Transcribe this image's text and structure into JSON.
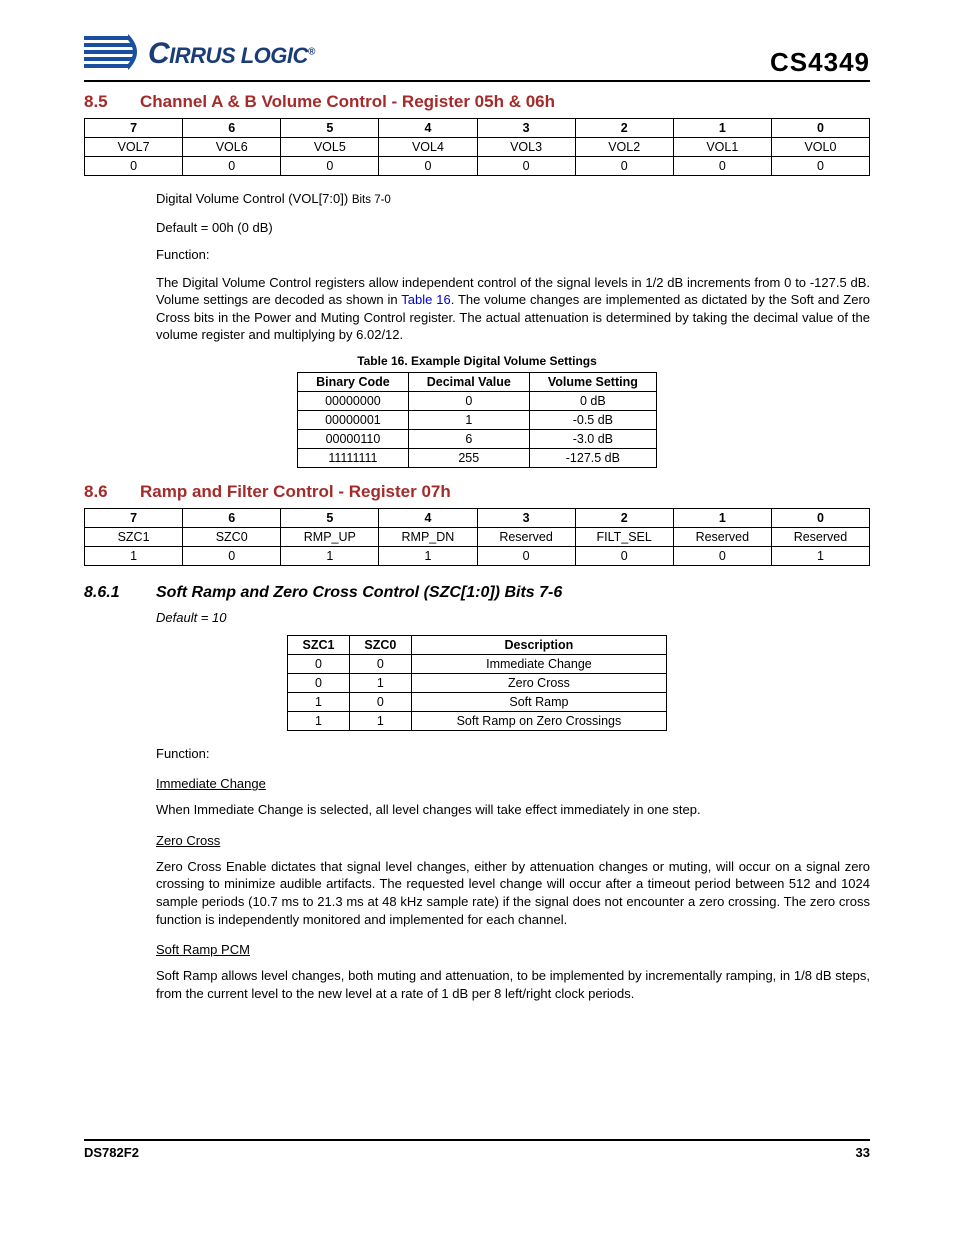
{
  "header": {
    "company": "IRRUS LOGIC",
    "part": "CS4349"
  },
  "section85": {
    "num": "8.5",
    "title": "Channel A & B Volume Control - Register 05h & 06h",
    "bits": [
      "7",
      "6",
      "5",
      "4",
      "3",
      "2",
      "1",
      "0"
    ],
    "names": [
      "VOL7",
      "VOL6",
      "VOL5",
      "VOL4",
      "VOL3",
      "VOL2",
      "VOL1",
      "VOL0"
    ],
    "reset": [
      "0",
      "0",
      "0",
      "0",
      "0",
      "0",
      "0",
      "0"
    ],
    "fieldline": "Digital Volume Control (VOL[7:0])",
    "fieldbits": "Bits 7-0",
    "default": "Default = 00h (0 dB)",
    "func_label": "Function:",
    "func_text_a": "The Digital Volume Control registers allow independent control of the signal levels in 1/2 dB increments from 0 to -127.5 dB. Volume settings are decoded as shown in ",
    "func_link": "Table 16",
    "func_text_b": ". The volume changes are implemented as dictated by the Soft and Zero Cross bits in the Power and Muting Control register. The actual attenuation is determined by taking the decimal value of the volume register and multiplying by 6.02/12."
  },
  "table16": {
    "caption": "Table 16. Example Digital Volume Settings",
    "headers": [
      "Binary Code",
      "Decimal Value",
      "Volume Setting"
    ],
    "rows": [
      [
        "00000000",
        "0",
        "0 dB"
      ],
      [
        "00000001",
        "1",
        "-0.5 dB"
      ],
      [
        "00000110",
        "6",
        "-3.0 dB"
      ],
      [
        "11111111",
        "255",
        "-127.5 dB"
      ]
    ]
  },
  "section86": {
    "num": "8.6",
    "title": "Ramp and Filter Control - Register 07h",
    "bits": [
      "7",
      "6",
      "5",
      "4",
      "3",
      "2",
      "1",
      "0"
    ],
    "names": [
      "SZC1",
      "SZC0",
      "RMP_UP",
      "RMP_DN",
      "Reserved",
      "FILT_SEL",
      "Reserved",
      "Reserved"
    ],
    "reset": [
      "1",
      "0",
      "1",
      "1",
      "0",
      "0",
      "0",
      "1"
    ]
  },
  "section861": {
    "num": "8.6.1",
    "title": "Soft Ramp and Zero Cross Control (SZC[1:0]) Bits 7-6",
    "default": "Default = 10",
    "headers": [
      "SZC1",
      "SZC0",
      "Description"
    ],
    "rows": [
      [
        "0",
        "0",
        "Immediate Change"
      ],
      [
        "0",
        "1",
        "Zero Cross"
      ],
      [
        "1",
        "0",
        "Soft Ramp"
      ],
      [
        "1",
        "1",
        "Soft Ramp on Zero Crossings"
      ]
    ],
    "func_label": "Function:",
    "imm_label": "Immediate Change",
    "imm_text": "When Immediate Change is selected, all level changes will take effect immediately in one step.",
    "zc_label": "Zero Cross",
    "zc_text": "Zero Cross Enable dictates that signal level changes, either by attenuation changes or muting, will occur on a signal zero crossing to minimize audible artifacts. The requested level change will occur after a timeout period between 512 and 1024 sample periods (10.7 ms to 21.3 ms at 48 kHz sample rate) if the signal does not encounter a zero crossing. The zero cross function is independently monitored and implemented for each channel.",
    "sr_label": "Soft Ramp PCM",
    "sr_text": "Soft Ramp allows level changes, both muting and attenuation, to be implemented by incrementally ramping, in 1/8 dB steps, from the current level to the new level at a rate of 1 dB per 8 left/right clock periods."
  },
  "footer": {
    "doc": "DS782F2",
    "page": "33"
  }
}
